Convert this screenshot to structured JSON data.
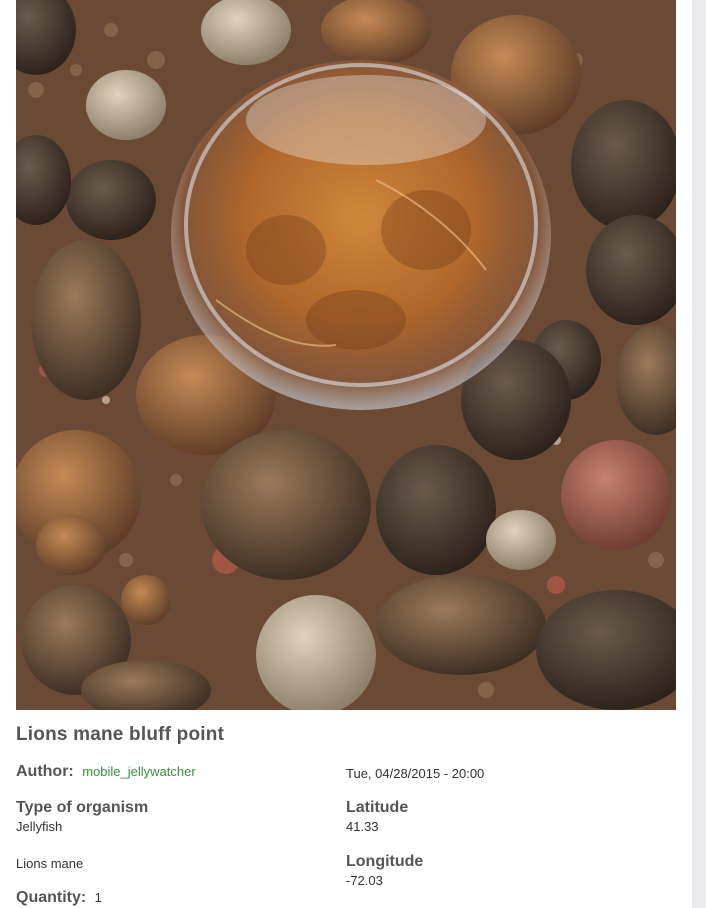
{
  "post": {
    "title": "Lions mane bluff point",
    "author_label": "Author:",
    "author_name": "mobile_jellywatcher",
    "date": "Tue, 04/28/2015 - 20:00",
    "type_label": "Type of organism",
    "type_value": "Jellyfish",
    "common_name": "Lions mane",
    "quantity_label": "Quantity:",
    "quantity_value": "1",
    "latitude_label": "Latitude",
    "latitude_value": "41.33",
    "longitude_label": "Longitude",
    "longitude_value": "-72.03"
  },
  "colors": {
    "link": "#3f8f3f",
    "label": "#555555"
  }
}
